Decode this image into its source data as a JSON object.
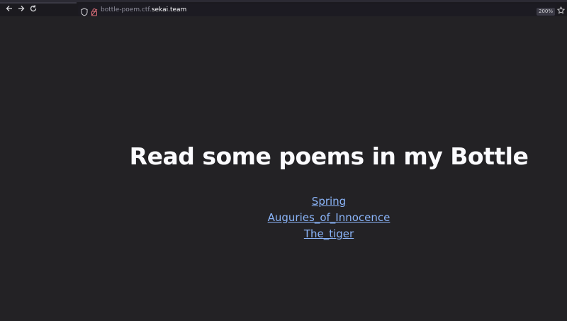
{
  "browser": {
    "url_prefix": "bottle-poem.ctf.",
    "url_host": "sekai.team",
    "zoom": "200%",
    "icons": {
      "back": "back-arrow-icon",
      "forward": "forward-arrow-icon",
      "reload": "reload-icon",
      "shield": "shield-icon",
      "lock": "insecure-lock-icon",
      "bookmark": "star-icon"
    }
  },
  "page": {
    "title": "Read some poems in my Bottle",
    "links": [
      {
        "label": "Spring"
      },
      {
        "label": "Auguries_of_Innocence"
      },
      {
        "label": "The_tiger"
      }
    ]
  },
  "colors": {
    "background": "#232225",
    "link": "#8ab4f8",
    "title": "#fbfbfe"
  }
}
